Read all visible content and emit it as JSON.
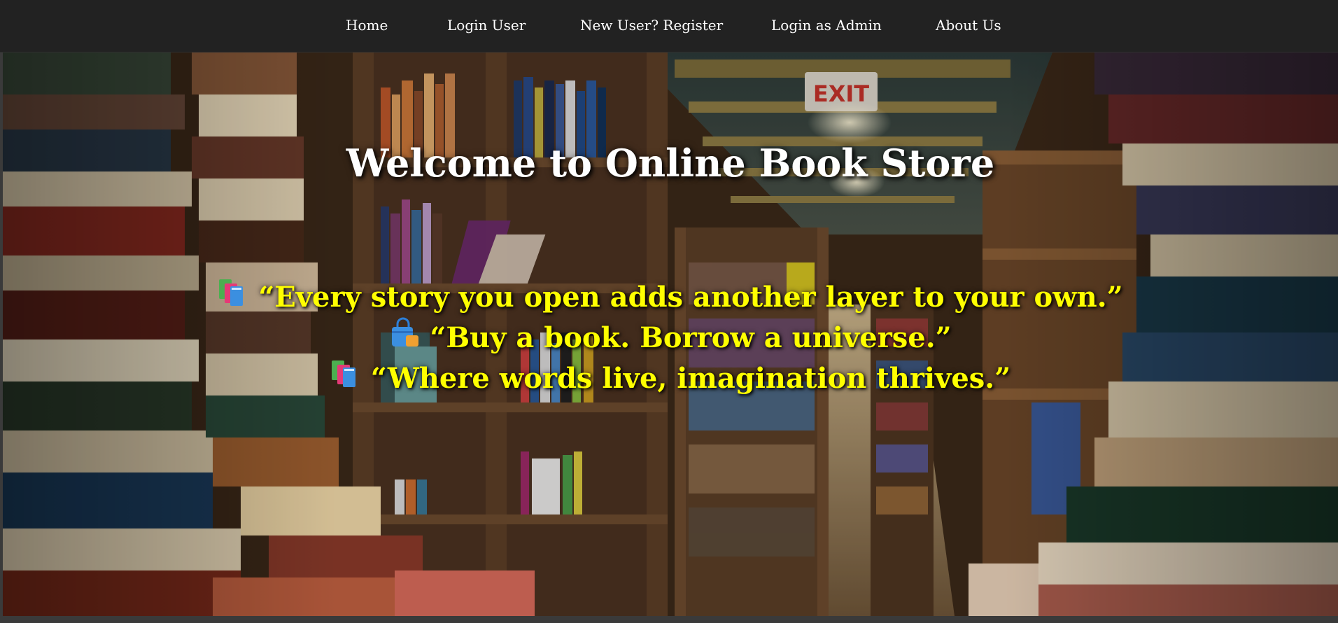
{
  "nav": {
    "items": [
      {
        "label": "Home"
      },
      {
        "label": "Login User"
      },
      {
        "label": "New User? Register"
      },
      {
        "label": "Login as Admin"
      },
      {
        "label": "About Us"
      }
    ]
  },
  "hero": {
    "title": "Welcome to Online Book Store",
    "quotes": [
      {
        "icon": "books-icon",
        "text": "“Every story you open adds another layer to your own.”"
      },
      {
        "icon": "shopping-bag-icon",
        "text": "“Buy a book. Borrow a universe.”"
      },
      {
        "icon": "books-icon",
        "text": "“Where words live, imagination thrives.”"
      }
    ]
  },
  "colors": {
    "navbar": "#222222",
    "title": "#ffffff",
    "quote": "#ffff00"
  }
}
